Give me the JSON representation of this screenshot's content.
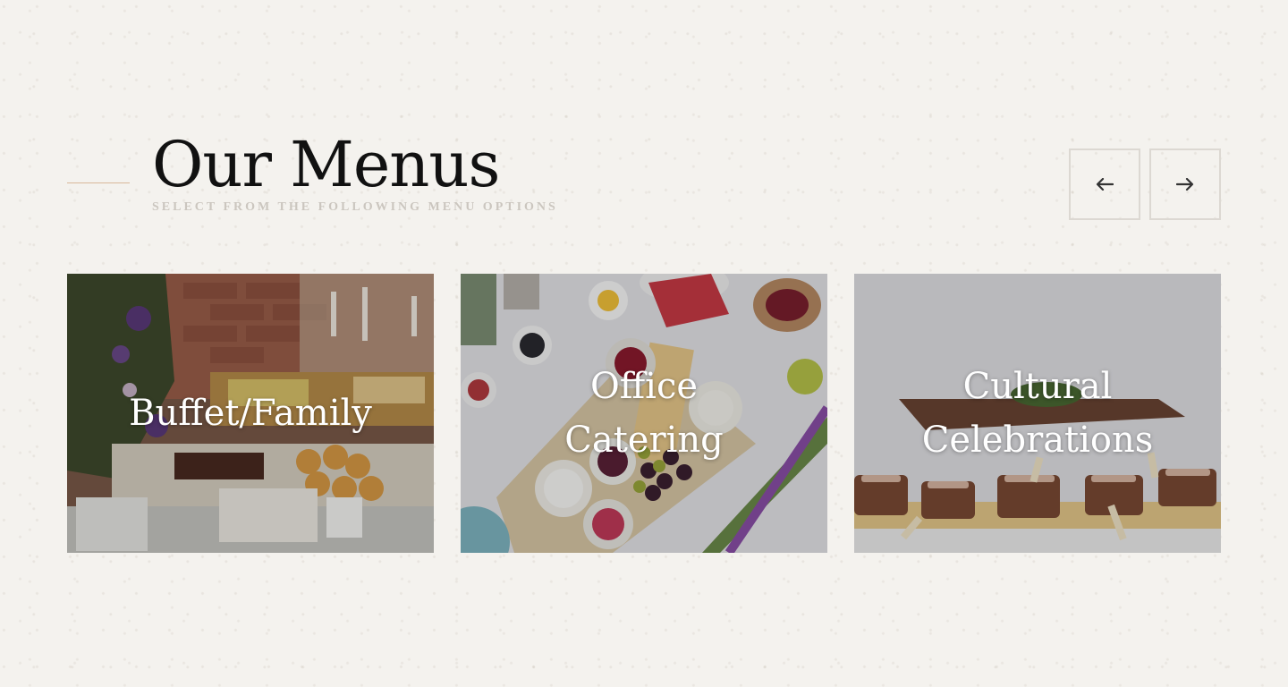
{
  "header": {
    "title": "Our Menus",
    "subtitle": "SELECT FROM THE FOLLOWING MENU OPTIONS"
  },
  "carousel": {
    "prev_icon": "arrow-left-icon",
    "next_icon": "arrow-right-icon"
  },
  "menus": [
    {
      "label": "Buffet/Family",
      "image": "buffet-table-photo"
    },
    {
      "label": "Office Catering",
      "image": "platter-spread-photo"
    },
    {
      "label": "Cultural Celebrations",
      "image": "plated-appetizers-photo"
    }
  ],
  "colors": {
    "background": "#f4f2ee",
    "accent_line": "#d9b89a",
    "subtitle": "#cbc6bf",
    "title": "#111111",
    "button_border": "#dcd8d2"
  }
}
